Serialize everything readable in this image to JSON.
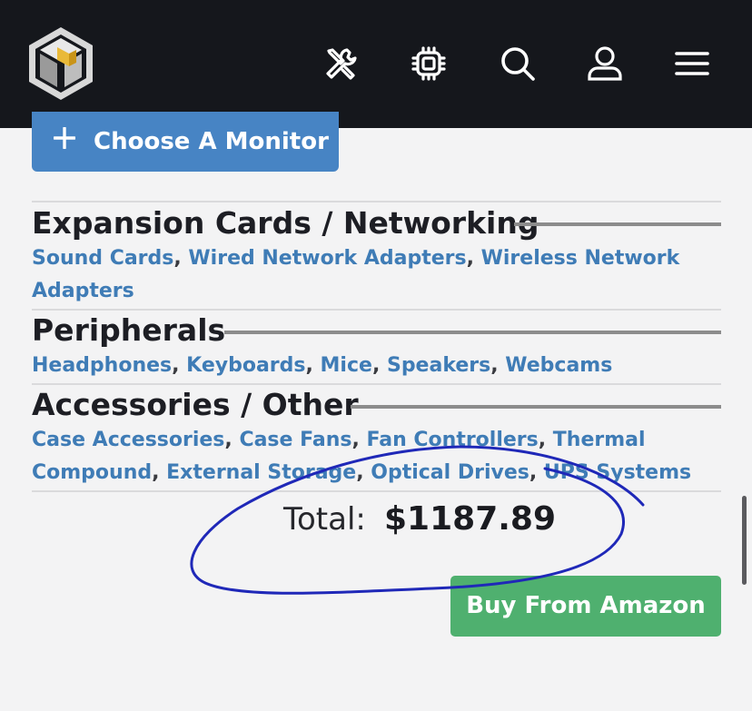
{
  "header": {
    "icons": [
      "logo-cube-icon",
      "tools-icon",
      "cpu-chip-icon",
      "search-icon",
      "user-icon",
      "menu-icon"
    ]
  },
  "monitor": {
    "choose_label": "Choose A Monitor"
  },
  "sections": [
    {
      "title": "Expansion Cards / Networking",
      "links_line1": [
        "Sound Cards",
        "Wired Network Adapters",
        "Wireless Network"
      ],
      "links_line2": [
        "Adapters"
      ]
    },
    {
      "title": "Peripherals",
      "links_line1": [
        "Headphones",
        "Keyboards",
        "Mice",
        "Speakers",
        "Webcams"
      ]
    },
    {
      "title": "Accessories / Other",
      "links_line1": [
        "Case Accessories",
        "Case Fans",
        "Fan Controllers",
        "Thermal"
      ],
      "links_line2": [
        "Compound",
        "External Storage",
        "Optical Drives",
        "UPS Systems"
      ]
    }
  ],
  "total": {
    "label": "Total:",
    "value": "$1187.89"
  },
  "buy": {
    "label": "Buy From Amazon"
  },
  "colors": {
    "header_bg": "#15171c",
    "link": "#3f7cb6",
    "primary_button": "#4784c4",
    "buy_button": "#4fb06f",
    "annotation_ink": "#1f28b8"
  }
}
